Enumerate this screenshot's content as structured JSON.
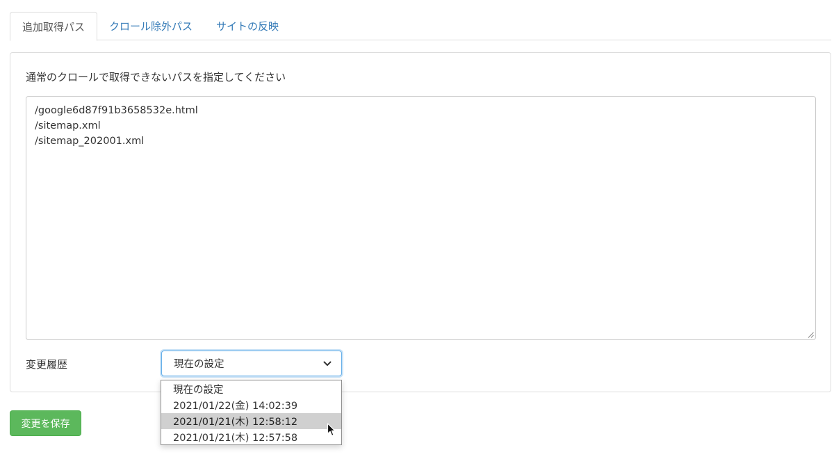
{
  "tabs": [
    {
      "label": "追加取得パス",
      "active": true
    },
    {
      "label": "クロール除外パス",
      "active": false
    },
    {
      "label": "サイトの反映",
      "active": false
    }
  ],
  "panel": {
    "instruction": "通常のクロールで取得できないパスを指定してください",
    "paths": [
      "/google6d87f91b3658532e.html",
      "/sitemap.xml",
      "/sitemap_202001.xml"
    ],
    "history_label": "変更履歴",
    "history_selected": "現在の設定"
  },
  "dropdown": {
    "options": [
      "現在の設定",
      "2021/01/22(金) 14:02:39",
      "2021/01/21(木) 12:58:12",
      "2021/01/21(木) 12:57:58"
    ],
    "hovered_index": 2
  },
  "actions": {
    "save_label": "変更を保存"
  },
  "colors": {
    "link": "#337ab7",
    "save_button": "#5cb85c",
    "focus_border": "#66afe9",
    "hover_option": "#d0d0d0"
  }
}
